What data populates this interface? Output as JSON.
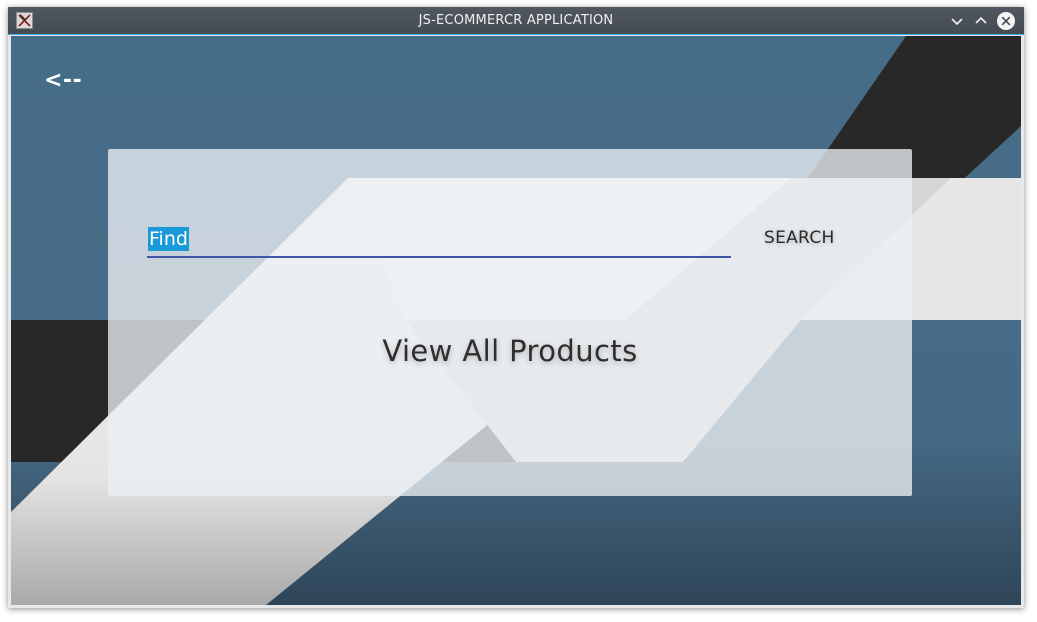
{
  "window": {
    "title": "JS-ECOMMERCR APPLICATION",
    "icon": "app-x-logo-icon",
    "controls": [
      "minimize-icon",
      "maximize-icon",
      "close-icon"
    ]
  },
  "nav": {
    "back_label": "<--"
  },
  "search": {
    "value": "Find",
    "button_label": "SEARCH"
  },
  "main": {
    "view_all_label": "View All Products"
  },
  "colors": {
    "background": "#466d88",
    "accent_selection": "#1a9ad6",
    "field_underline": "#3e56a3",
    "dark_stripe": "#282828",
    "light_stripe": "#e6e6e6",
    "titlebar": "#4b5259"
  }
}
